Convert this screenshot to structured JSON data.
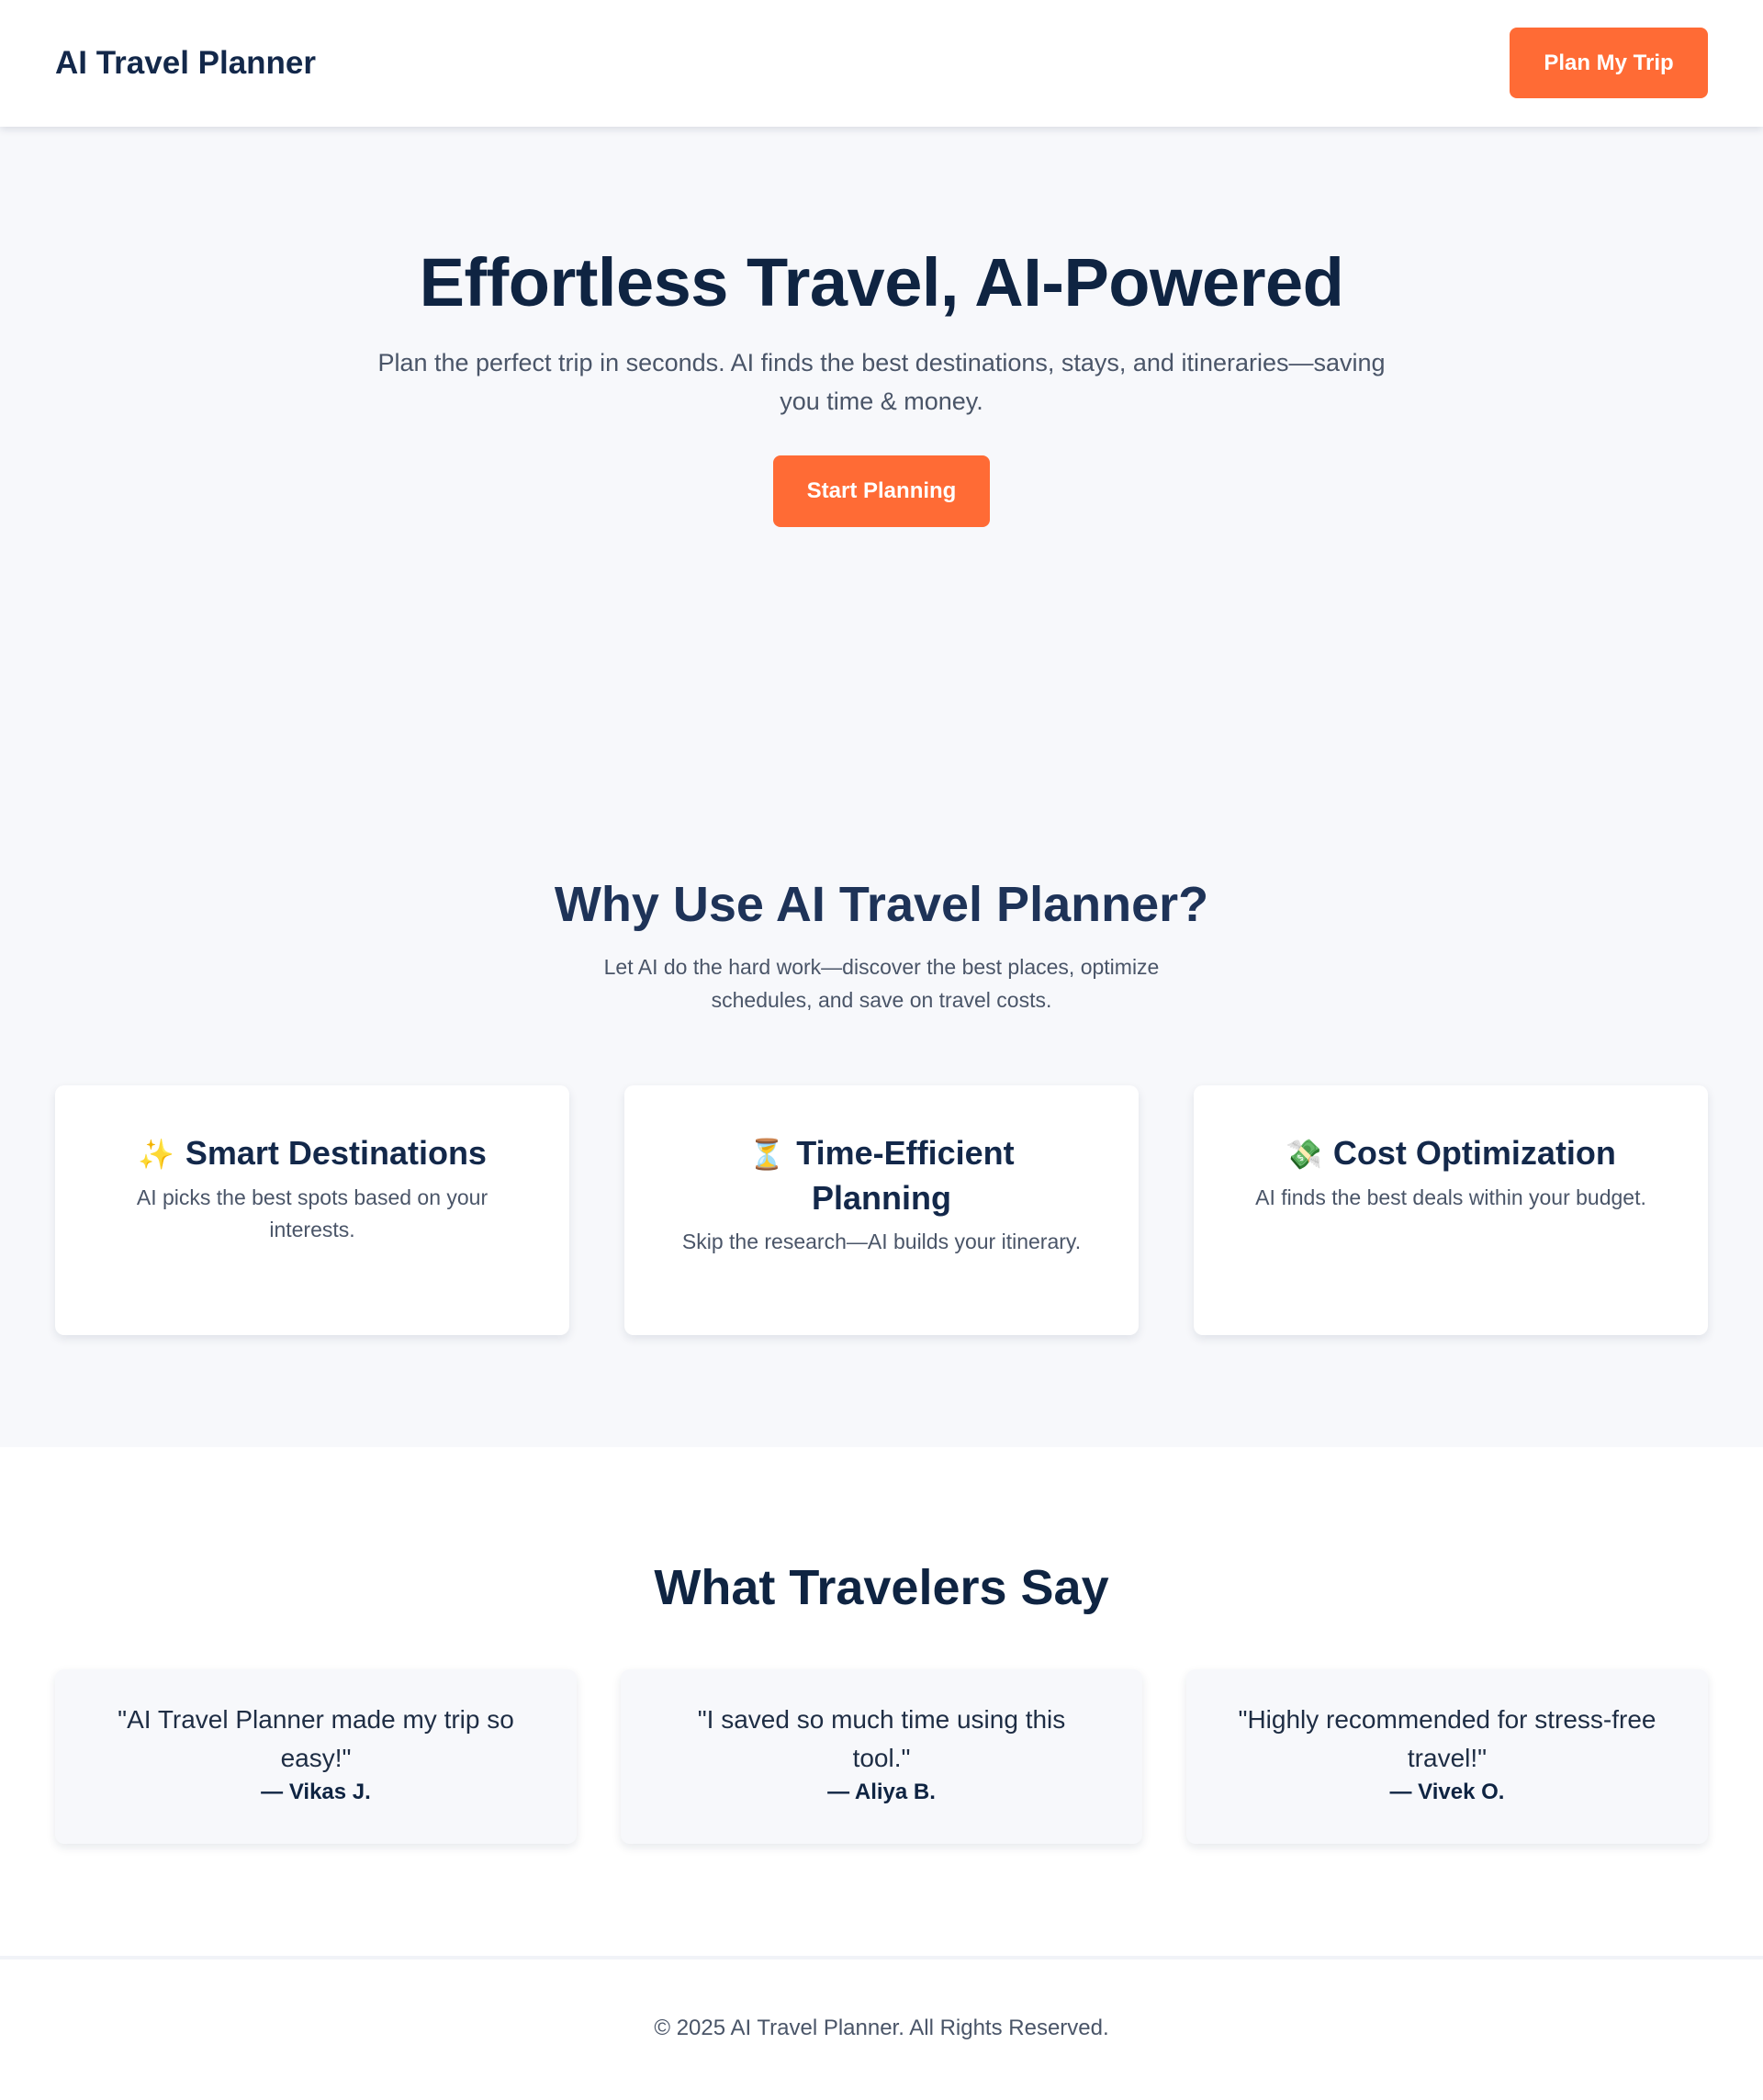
{
  "header": {
    "logo": "AI Travel Planner",
    "cta_label": "Plan My Trip"
  },
  "hero": {
    "title": "Effortless Travel, AI-Powered",
    "subtitle": "Plan the perfect trip in seconds. AI finds the best destinations, stays, and itineraries—saving you time & money.",
    "cta_label": "Start Planning"
  },
  "features": {
    "title": "Why Use AI Travel Planner?",
    "subtitle": "Let AI do the hard work—discover the best places, optimize schedules, and save on travel costs.",
    "cards": [
      {
        "icon": "✨",
        "title": "Smart Destinations",
        "description": "AI picks the best spots based on your interests."
      },
      {
        "icon": "⏳",
        "title": "Time-Efficient Planning",
        "description": "Skip the research—AI builds your itinerary."
      },
      {
        "icon": "💸",
        "title": "Cost Optimization",
        "description": "AI finds the best deals within your budget."
      }
    ]
  },
  "testimonials": {
    "title": "What Travelers Say",
    "items": [
      {
        "quote": "\"AI Travel Planner made my trip so easy!\"",
        "author": "— Vikas J."
      },
      {
        "quote": "\"I saved so much time using this tool.\"",
        "author": "— Aliya B."
      },
      {
        "quote": "\"Highly recommended for stress-free travel!\"",
        "author": "— Vivek O."
      }
    ]
  },
  "footer": {
    "text": "© 2025 AI Travel Planner. All Rights Reserved."
  },
  "colors": {
    "accent": "#ff6b35",
    "heading": "#0f2442",
    "body_text": "#4a5568",
    "page_bg": "#f7f8fb"
  }
}
